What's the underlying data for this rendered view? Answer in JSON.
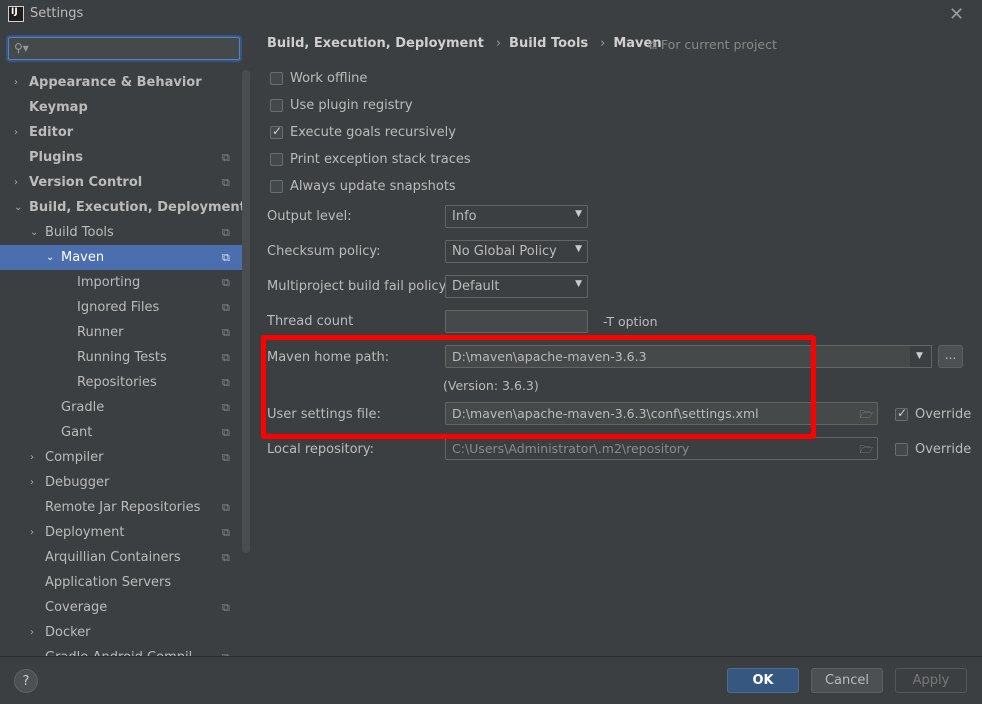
{
  "window": {
    "title": "Settings",
    "app_icon": "IJ"
  },
  "search": {
    "placeholder": "",
    "icon": "search-icon"
  },
  "tree": [
    {
      "label": "Appearance & Behavior",
      "indent": 0,
      "arrow": "›",
      "bold": true,
      "project": ""
    },
    {
      "label": "Keymap",
      "indent": 0,
      "arrow": "",
      "bold": true,
      "project": ""
    },
    {
      "label": "Editor",
      "indent": 0,
      "arrow": "›",
      "bold": true,
      "project": ""
    },
    {
      "label": "Plugins",
      "indent": 0,
      "arrow": "",
      "bold": true,
      "project": "⧉"
    },
    {
      "label": "Version Control",
      "indent": 0,
      "arrow": "›",
      "bold": true,
      "project": "⧉"
    },
    {
      "label": "Build, Execution, Deployment",
      "indent": 0,
      "arrow": "⌄",
      "bold": true,
      "project": ""
    },
    {
      "label": "Build Tools",
      "indent": 1,
      "arrow": "⌄",
      "bold": false,
      "project": "⧉"
    },
    {
      "label": "Maven",
      "indent": 2,
      "arrow": "⌄",
      "bold": false,
      "project": "⧉",
      "selected": true
    },
    {
      "label": "Importing",
      "indent": 3,
      "arrow": "",
      "bold": false,
      "project": "⧉"
    },
    {
      "label": "Ignored Files",
      "indent": 3,
      "arrow": "",
      "bold": false,
      "project": "⧉"
    },
    {
      "label": "Runner",
      "indent": 3,
      "arrow": "",
      "bold": false,
      "project": "⧉"
    },
    {
      "label": "Running Tests",
      "indent": 3,
      "arrow": "",
      "bold": false,
      "project": "⧉"
    },
    {
      "label": "Repositories",
      "indent": 3,
      "arrow": "",
      "bold": false,
      "project": "⧉"
    },
    {
      "label": "Gradle",
      "indent": 2,
      "arrow": "",
      "bold": false,
      "project": "⧉"
    },
    {
      "label": "Gant",
      "indent": 2,
      "arrow": "",
      "bold": false,
      "project": "⧉"
    },
    {
      "label": "Compiler",
      "indent": 1,
      "arrow": "›",
      "bold": false,
      "project": "⧉"
    },
    {
      "label": "Debugger",
      "indent": 1,
      "arrow": "›",
      "bold": false,
      "project": ""
    },
    {
      "label": "Remote Jar Repositories",
      "indent": 1,
      "arrow": "",
      "bold": false,
      "project": "⧉"
    },
    {
      "label": "Deployment",
      "indent": 1,
      "arrow": "›",
      "bold": false,
      "project": "⧉"
    },
    {
      "label": "Arquillian Containers",
      "indent": 1,
      "arrow": "",
      "bold": false,
      "project": "⧉"
    },
    {
      "label": "Application Servers",
      "indent": 1,
      "arrow": "",
      "bold": false,
      "project": ""
    },
    {
      "label": "Coverage",
      "indent": 1,
      "arrow": "",
      "bold": false,
      "project": "⧉"
    },
    {
      "label": "Docker",
      "indent": 1,
      "arrow": "›",
      "bold": false,
      "project": ""
    },
    {
      "label": "Gradle-Android Compil...",
      "indent": 1,
      "arrow": "",
      "bold": false,
      "project": "⧉"
    }
  ],
  "breadcrumb": {
    "parts": [
      "Build, Execution, Deployment",
      "Build Tools",
      "Maven"
    ],
    "separator": "›",
    "for_project": "For current project",
    "for_project_icon": "⧉"
  },
  "checkboxes": [
    {
      "label": "Work offline",
      "checked": false
    },
    {
      "label": "Use plugin registry",
      "checked": false
    },
    {
      "label": "Execute goals recursively",
      "checked": true
    },
    {
      "label": "Print exception stack traces",
      "checked": false
    },
    {
      "label": "Always update snapshots",
      "checked": false
    }
  ],
  "output_level": {
    "label": "Output level:",
    "value": "Info"
  },
  "checksum_policy": {
    "label": "Checksum policy:",
    "value": "No Global Policy"
  },
  "fail_policy": {
    "label": "Multiproject build fail policy:",
    "value": "Default"
  },
  "thread_count": {
    "label": "Thread count",
    "value": "",
    "hint": "-T option"
  },
  "maven_home": {
    "label": "Maven home path:",
    "value": "D:\\maven\\apache-maven-3.6.3",
    "version": "(Version: 3.6.3)",
    "browse": "..."
  },
  "user_settings": {
    "label": "User settings file:",
    "value": "D:\\maven\\apache-maven-3.6.3\\conf\\settings.xml",
    "override_label": "Override",
    "override_checked": true
  },
  "local_repo": {
    "label": "Local repository:",
    "value": "C:\\Users\\Administrator\\.m2\\repository",
    "override_label": "Override",
    "override_checked": false
  },
  "buttons": {
    "help": "?",
    "ok": "OK",
    "cancel": "Cancel",
    "apply": "Apply"
  },
  "colors": {
    "background": "#3c3f41",
    "selection": "#4b6eaf",
    "highlight": "#ff0000",
    "ok_button": "#365880"
  }
}
